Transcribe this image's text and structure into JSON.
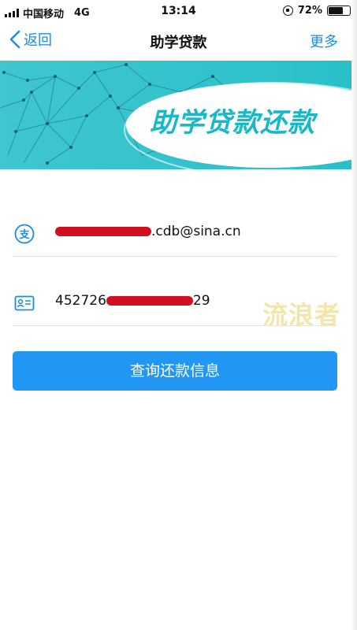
{
  "status_bar": {
    "carrier": "中国移动",
    "network": "4G",
    "time": "13:14",
    "battery": "72%",
    "battery_level": 0.72
  },
  "nav": {
    "back_label": "返回",
    "title": "助学贷款",
    "more_label": "更多"
  },
  "banner": {
    "title": "助学贷款还款"
  },
  "form": {
    "email_value": ".cdb@sina.cn",
    "id_prefix": "452726",
    "id_suffix": "29"
  },
  "query_button": {
    "label": "查询还款信息"
  },
  "watermark": "流浪者",
  "colors": {
    "accent": "#1a8ee6",
    "button": "#2196f3",
    "banner_teal": "#19b8c8",
    "redaction": "#cf1020"
  }
}
